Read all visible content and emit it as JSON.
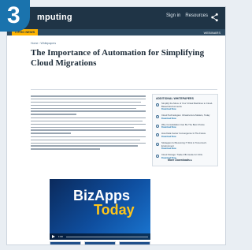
{
  "step_number": "3",
  "site": {
    "brand": "mputing",
    "top_links": [
      "Sign in",
      "Resources"
    ],
    "subnav_active": "ITPRO NEWS",
    "subnav_right": "WEBINARS"
  },
  "breadcrumb": "Home › Whitepapers",
  "article": {
    "title": "The Importance of Automation for Simplifying Cloud Migrations"
  },
  "sidebar": {
    "title": "ADDITIONAL WHITEPAPERS",
    "items": [
      {
        "text": "Simplify the Move of Your Virtual Machines to Cloud-Based Environments",
        "cta": "Download Now"
      },
      {
        "text": "Cloud Technologies: Infrastructure Matters, Today",
        "cta": "Download Now"
      },
      {
        "text": "Why Consolidation Can Be The Best Choice",
        "cta": "Download Now"
      },
      {
        "text": "How Data Center Convergence Is The Future",
        "cta": "Download Now"
      },
      {
        "text": "Strategies for Becoming IT First in Tomorrow's Environment",
        "cta": "Download Now"
      },
      {
        "text": "Cloud Storage: Trade-Offs Guide for CIOs",
        "cta": "Download Now"
      }
    ],
    "more": "More Downloads ▸"
  },
  "video": {
    "line1": "BizApps",
    "line2": "Today",
    "time": "1:00",
    "progress": 0
  },
  "colors": {
    "header": "#1f3446",
    "accent": "#1a73ad",
    "tab_active": "#ffb400"
  }
}
